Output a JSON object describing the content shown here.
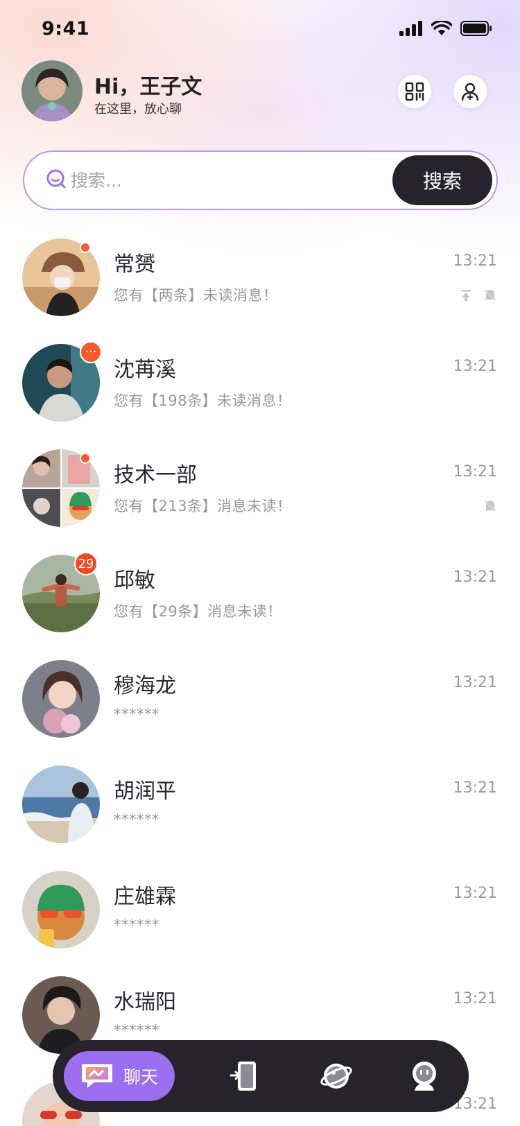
{
  "status_bar": {
    "time": "9:41"
  },
  "header": {
    "greeting": "Hi，王子文",
    "subtitle": "在这里，放心聊"
  },
  "search": {
    "placeholder": "搜索...",
    "button_label": "搜索"
  },
  "chats": [
    {
      "name": "常赟",
      "message": "您有【两条】未读消息！",
      "time": "13:21",
      "badge": "dot",
      "pinned": true,
      "muted": true,
      "avatar_color": "#c9a27c"
    },
    {
      "name": "沈苒溪",
      "message": "您有【198条】未读消息！",
      "time": "13:21",
      "badge": "···",
      "pinned": false,
      "muted": false,
      "avatar_color": "#2f5560"
    },
    {
      "name": "技术一部",
      "message": "您有【213条】消息未读！",
      "time": "13:21",
      "badge": "dot",
      "pinned": false,
      "muted": true,
      "avatar_color": "#5b4a4a"
    },
    {
      "name": "邱敏",
      "message": "您有【29条】消息未读！",
      "time": "13:21",
      "badge": "29",
      "pinned": false,
      "muted": false,
      "avatar_color": "#6f7f58"
    },
    {
      "name": "穆海龙",
      "message": "******",
      "time": "13:21",
      "badge": "",
      "pinned": false,
      "muted": false,
      "avatar_color": "#a88f93"
    },
    {
      "name": "胡润平",
      "message": "******",
      "time": "13:21",
      "badge": "",
      "pinned": false,
      "muted": false,
      "avatar_color": "#6e8fad"
    },
    {
      "name": "庄雄霖",
      "message": "******",
      "time": "13:21",
      "badge": "",
      "pinned": false,
      "muted": false,
      "avatar_color": "#c07a3e"
    },
    {
      "name": "水瑞阳",
      "message": "******",
      "time": "13:21",
      "badge": "",
      "pinned": false,
      "muted": false,
      "avatar_color": "#4b4040"
    },
    {
      "name": "",
      "message": "",
      "time": "13:21",
      "badge": "",
      "pinned": false,
      "muted": false,
      "avatar_color": "#d9b8a0"
    }
  ],
  "tabbar": {
    "active_label": "聊天",
    "icons": [
      "chat-icon",
      "device-icon",
      "planet-icon",
      "robot-icon"
    ]
  },
  "colors": {
    "accent": "#9b6ff0",
    "dark": "#27232c",
    "badge": "#f55a2a"
  }
}
